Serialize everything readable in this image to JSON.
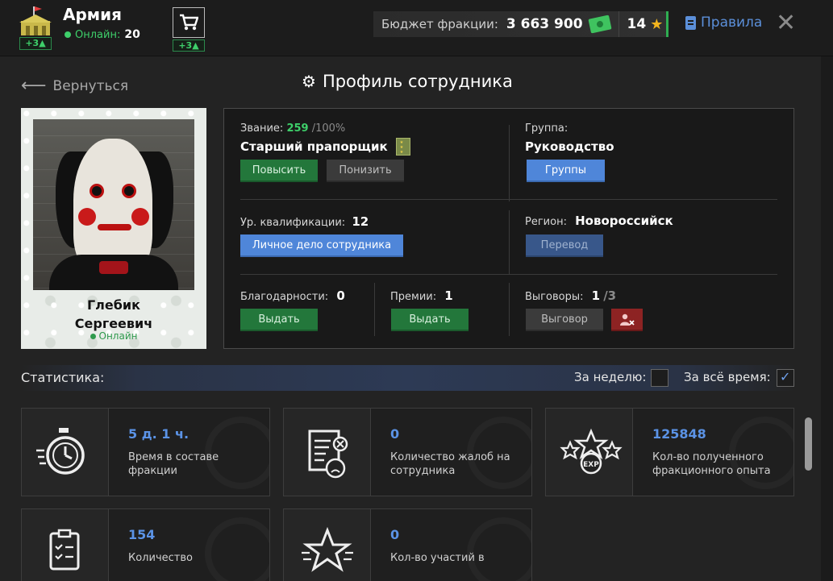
{
  "topbar": {
    "faction_name": "Армия",
    "faction_badge": "+3",
    "online_label": "Онлайн:",
    "online_count": "20",
    "cart_badge": "+3",
    "budget_label": "Бюджет фракции:",
    "budget_value": "3 663 900",
    "stars_value": "14",
    "rules_label": "Правила"
  },
  "header": {
    "back_label": "Вернуться",
    "title": "Профиль сотрудника"
  },
  "employee": {
    "first_name": "Глебик",
    "last_name": "Сергеевич",
    "status": "Онлайн"
  },
  "info": {
    "rank_label": "Звание:",
    "rank_points": "259",
    "rank_max": "/100%",
    "rank_name": "Старший прапорщик",
    "promote_label": "Повысить",
    "demote_label": "Понизить",
    "group_label": "Группа:",
    "group_value": "Руководство",
    "groups_button": "Группы",
    "qual_label": "Ур. квалификации:",
    "qual_value": "12",
    "personal_file_button": "Личное дело сотрудника",
    "region_label": "Регион:",
    "region_value": "Новороссийск",
    "transfer_button": "Перевод",
    "thanks_label": "Благодарности:",
    "thanks_value": "0",
    "thanks_button": "Выдать",
    "bonus_label": "Премии:",
    "bonus_value": "1",
    "bonus_button": "Выдать",
    "reprimand_label": "Выговоры:",
    "reprimand_value": "1",
    "reprimand_max": "/3",
    "reprimand_button": "Выговор"
  },
  "stats": {
    "title": "Статистика:",
    "week_label": "За неделю:",
    "all_time_label": "За всё время:",
    "cards": [
      {
        "value": "5 д. 1 ч.",
        "desc": "Время в составе фракции"
      },
      {
        "value": "0",
        "desc": "Количество жалоб на сотрудника"
      },
      {
        "value": "125848",
        "desc": "Кол-во полученного фракционного опыта"
      },
      {
        "value": "154",
        "desc": "Количество"
      },
      {
        "value": "0",
        "desc": "Кол-во участий в"
      }
    ]
  },
  "colors": {
    "accent_blue": "#4f86d9",
    "accent_green": "#23773b",
    "online_green": "#3ecf6a",
    "star_gold": "#f3b51e"
  }
}
